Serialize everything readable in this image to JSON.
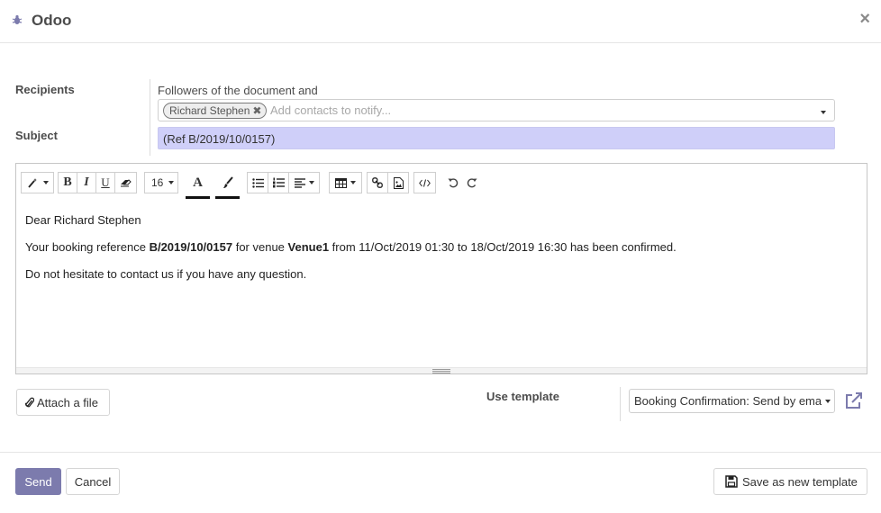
{
  "header": {
    "title": "Odoo",
    "close": "×"
  },
  "recipients": {
    "label": "Recipients",
    "followers_text": "Followers of the document and",
    "tags": [
      {
        "name": "Richard Stephen",
        "remove": "✖"
      }
    ],
    "placeholder": "Add contacts to notify..."
  },
  "subject": {
    "label": "Subject",
    "value": "(Ref B/2019/10/0157)"
  },
  "toolbar": {
    "bold": "B",
    "italic": "I",
    "underline": "U",
    "font_size": "16",
    "font_color": "A"
  },
  "body": {
    "greeting": "Dear Richard Stephen",
    "line2_prefix": "Your booking reference ",
    "booking_ref": "B/2019/10/0157",
    "line2_mid": " for venue ",
    "venue": "Venue1",
    "line2_suffix": " from 11/Oct/2019 01:30 to 18/Oct/2019 16:30 has been confirmed.",
    "line3": "Do not hesitate to contact us if you have any question."
  },
  "attachments": {
    "attach_label": "Attach a file"
  },
  "template": {
    "label": "Use template",
    "selected": "Booking Confirmation: Send by ema"
  },
  "footer": {
    "send_label": "Send",
    "cancel_label": "Cancel",
    "save_template_label": "Save as new template"
  },
  "colors": {
    "primary": "#7c7bad",
    "subject_bg": "#cfcff9",
    "header_text": "#4c4c4c"
  }
}
